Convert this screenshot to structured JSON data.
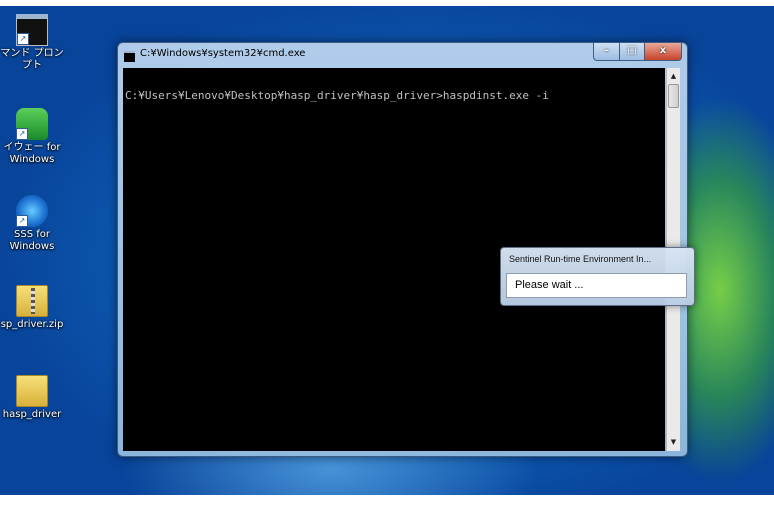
{
  "desktop": {
    "icons": [
      {
        "label_line1": "マンド プロン",
        "label_line2": "プト",
        "icon": "cmd-icon"
      },
      {
        "label_line1": "イウェー for",
        "label_line2": "Windows",
        "icon": "car-icon"
      },
      {
        "label_line1": "SSS for",
        "label_line2": "Windows",
        "icon": "sss-icon"
      },
      {
        "label_line1": "sp_driver.zip",
        "label_line2": "",
        "icon": "zip-folder-icon"
      },
      {
        "label_line1": "hasp_driver",
        "label_line2": "",
        "icon": "folder-icon"
      }
    ]
  },
  "cmd_window": {
    "title": "C:¥Windows¥system32¥cmd.exe",
    "console_line": "C:¥Users¥Lenovo¥Desktop¥hasp_driver¥hasp_driver>haspdinst.exe -i",
    "buttons": {
      "minimize": "–",
      "maximize": "□",
      "close": "x"
    },
    "scroll_up": "▲",
    "scroll_down": "▼"
  },
  "dialog": {
    "title": "Sentinel Run-time Environment In...",
    "message": "Please wait ..."
  }
}
